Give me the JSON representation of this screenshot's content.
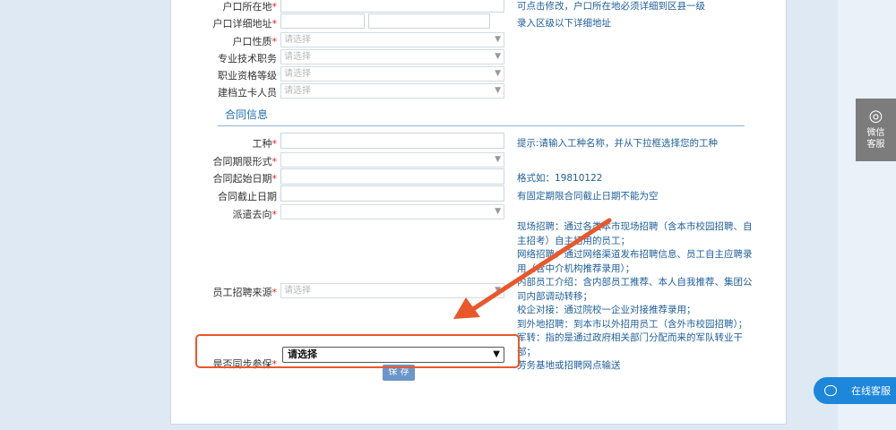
{
  "form": {
    "fields": [
      {
        "label": "户口所在地",
        "required": true,
        "type": "input"
      },
      {
        "label": "户口详细地址",
        "required": true,
        "type": "input-pair"
      },
      {
        "label": "户口性质",
        "required": true,
        "type": "select",
        "placeholder": "请选择"
      },
      {
        "label": "专业技术职务",
        "required": false,
        "type": "select",
        "placeholder": "请选择"
      },
      {
        "label": "职业资格等级",
        "required": false,
        "type": "select",
        "placeholder": "请选择"
      },
      {
        "label": "建档立卡人员",
        "required": false,
        "type": "select",
        "placeholder": "请选择"
      }
    ],
    "hints": {
      "hukou_location": "可点击修改，户口所在地必须详细到区县一级",
      "hukou_address": "录入区级以下详细地址"
    }
  },
  "contract": {
    "section_title": "合同信息",
    "fields": [
      {
        "label": "工种",
        "required": true,
        "type": "input"
      },
      {
        "label": "合同期限形式",
        "required": true,
        "type": "select",
        "placeholder": ""
      },
      {
        "label": "合同起始日期",
        "required": true,
        "type": "input"
      },
      {
        "label": "合同截止日期",
        "required": false,
        "type": "input"
      },
      {
        "label": "派遣去向",
        "required": true,
        "type": "select",
        "placeholder": ""
      }
    ],
    "hints": {
      "job_type": "提示:请输入工种名称，并从下拉框选择您的工种",
      "start_date": "格式如：19810122",
      "end_date": "有固定期限合同截止日期不能为空"
    },
    "recruit_source": {
      "label": "员工招聘来源",
      "placeholder": "请选择",
      "notes": [
        "现场招聘：通过各类本市现场招聘（含本市校园招聘、自主招考）自主招用的员工；",
        "网络招聘：通过网络渠道发布招聘信息、员工自主应聘录用（含中介机构推荐录用）；",
        "内部员工介绍：含内部员工推荐、本人自我推荐、集团公司内部调动转移；",
        "校企对接：通过院校一企业对接推荐录用；",
        "到外地招聘：到本市以外招用员工（含外市校园招聘）；",
        "军转：指的是通过政府相关部门分配而来的军队转业干部；",
        "劳务基地或招聘网点输送"
      ]
    },
    "sync_insurance": {
      "label": "是否同步参保",
      "value": "请选择"
    },
    "save_label": "保 存"
  },
  "side": {
    "wechat_label_1": "微信",
    "wechat_label_2": "客服",
    "wechat_icon": "wechat-icon",
    "online_label": "在线客服",
    "online_icon": "chat-bubble-icon"
  },
  "annotation": {
    "highlight_color": "#e8582a"
  }
}
